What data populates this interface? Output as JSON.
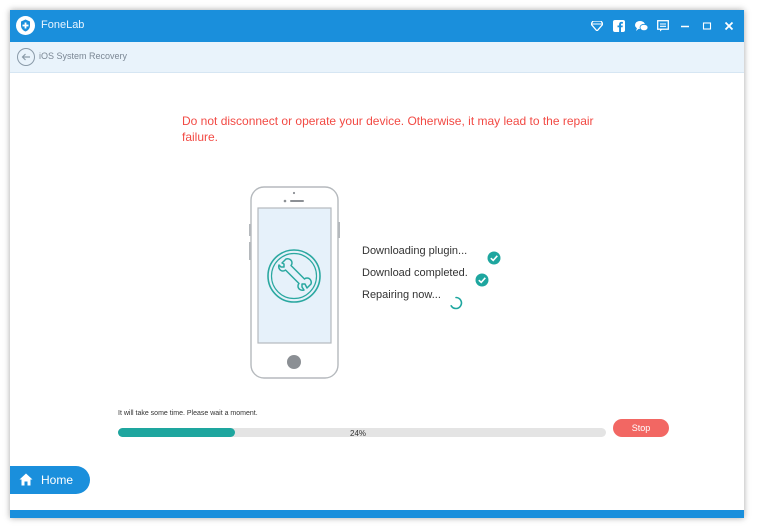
{
  "app": {
    "title": "FoneLab",
    "brand_color": "#1a8fdc",
    "window_controls": [
      "diamond-icon",
      "facebook-icon",
      "chat-icon",
      "feedback-icon",
      "minimize-icon",
      "maximize-icon",
      "close-icon"
    ]
  },
  "subheader": {
    "back_icon": "back-arrow-icon",
    "title": "iOS System Recovery"
  },
  "warning": {
    "text": "Do not disconnect or operate your device. Otherwise, it may lead to the repair failure.",
    "color": "#f24a44"
  },
  "device_illustration": {
    "icon": "wrench-icon",
    "accent_color": "#2aa8a0"
  },
  "steps": [
    {
      "label": "Downloading plugin...",
      "status": "done",
      "icon": "check-circle-icon"
    },
    {
      "label": "Download completed.",
      "status": "done",
      "icon": "check-circle-icon"
    },
    {
      "label": "Repairing now...",
      "status": "in-progress",
      "icon": "spinner-icon"
    }
  ],
  "progress": {
    "hint": "It will take some time. Please wait a moment.",
    "percent_label": "24%",
    "percent": 24,
    "fill_color": "#1ea69f"
  },
  "stop_button": {
    "label": "Stop",
    "color": "#f26763"
  },
  "home_button": {
    "label": "Home",
    "icon": "home-icon"
  }
}
